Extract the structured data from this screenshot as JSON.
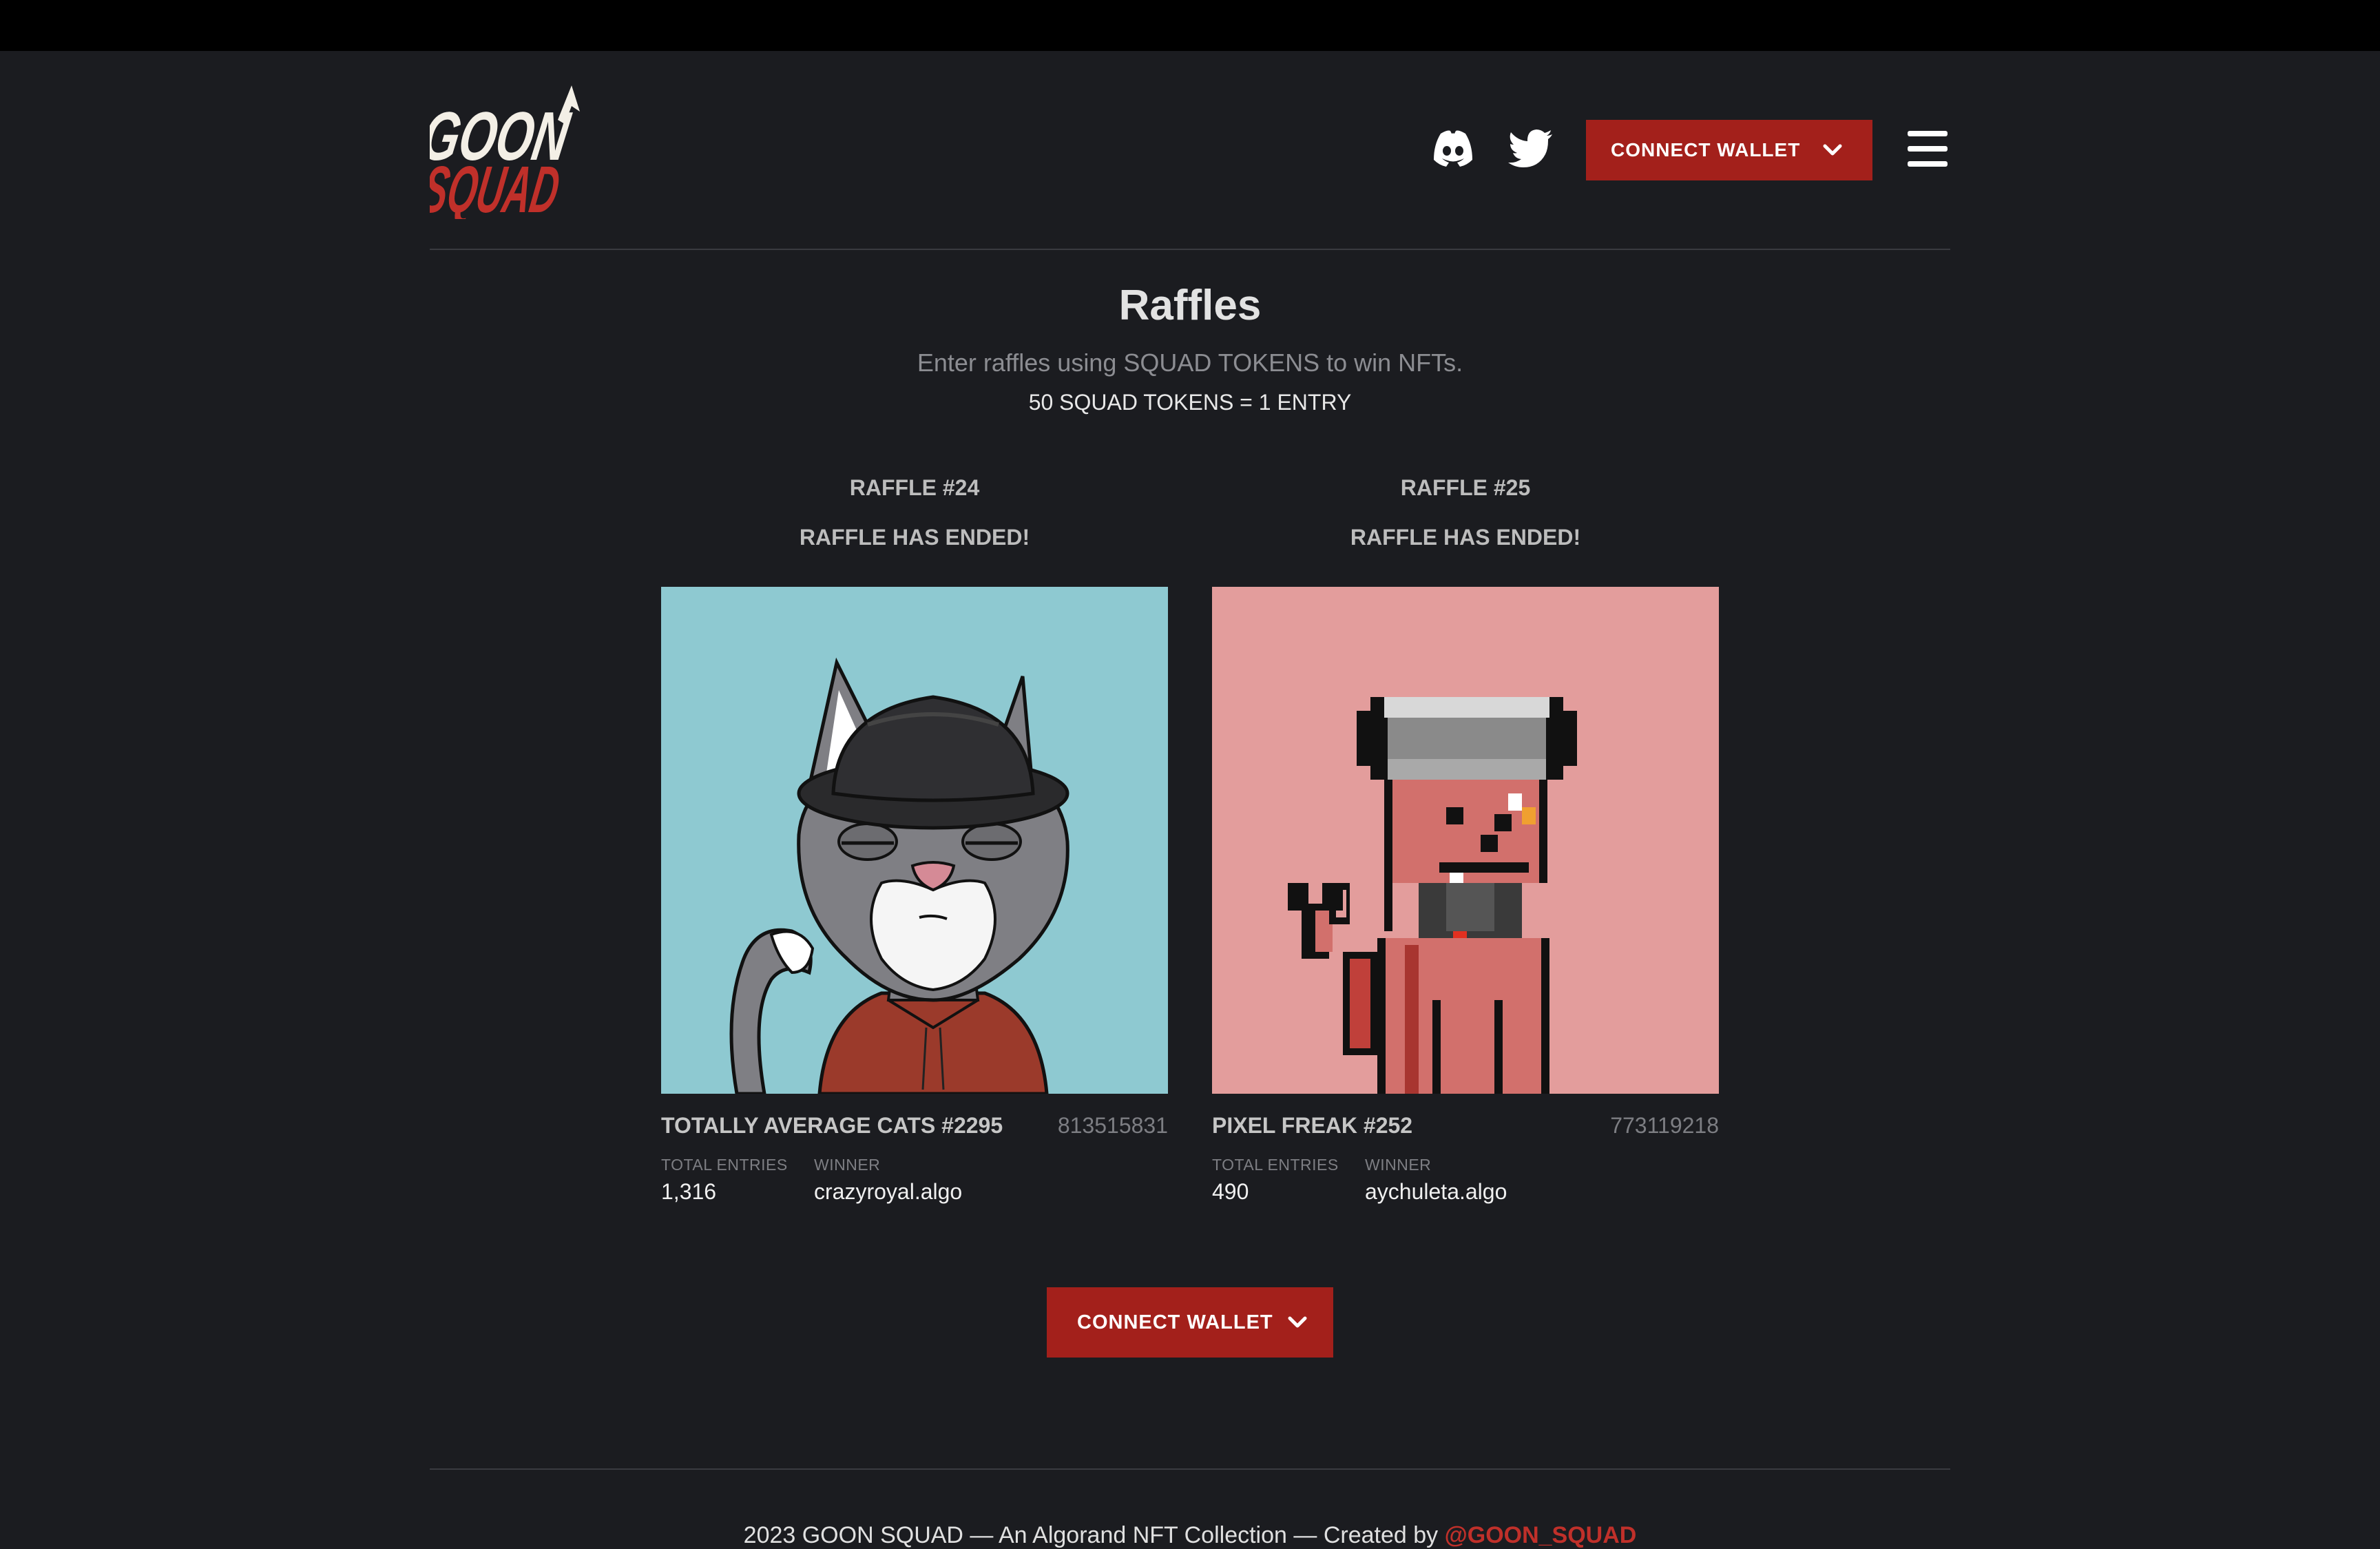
{
  "header": {
    "logo": {
      "line1": "GOON",
      "line2": "SQUAD"
    },
    "icons": [
      "discord-icon",
      "twitter-icon",
      "chevron-down-icon",
      "menu-icon"
    ],
    "connect_label": "CONNECT WALLET"
  },
  "page": {
    "title": "Raffles",
    "subtitle": "Enter raffles using SQUAD TOKENS to win NFTs.",
    "rate": "50 SQUAD TOKENS = 1 ENTRY"
  },
  "raffles": [
    {
      "number": "RAFFLE #24",
      "status": "RAFFLE HAS ENDED!",
      "nft_name": "TOTALLY AVERAGE CATS #2295",
      "asset_id": "813515831",
      "entries_label": "TOTAL ENTRIES",
      "entries": "1,316",
      "winner_label": "WINNER",
      "winner": "crazyroyal.algo",
      "background": "#8ec9d1"
    },
    {
      "number": "RAFFLE #25",
      "status": "RAFFLE HAS ENDED!",
      "nft_name": "PIXEL FREAK #252",
      "asset_id": "773119218",
      "entries_label": "TOTAL ENTRIES",
      "entries": "490",
      "winner_label": "WINNER",
      "winner": "aychuleta.algo",
      "background": "#e39d9c"
    }
  ],
  "bottom": {
    "connect_label": "CONNECT WALLET"
  },
  "footer": {
    "text": "2023 GOON SQUAD — An Algorand NFT Collection — Created by ",
    "brand": "@GOON_SQUAD"
  },
  "colors": {
    "background": "#1b1c20",
    "accent": "#a3201b",
    "brand_red": "#c0302a"
  }
}
